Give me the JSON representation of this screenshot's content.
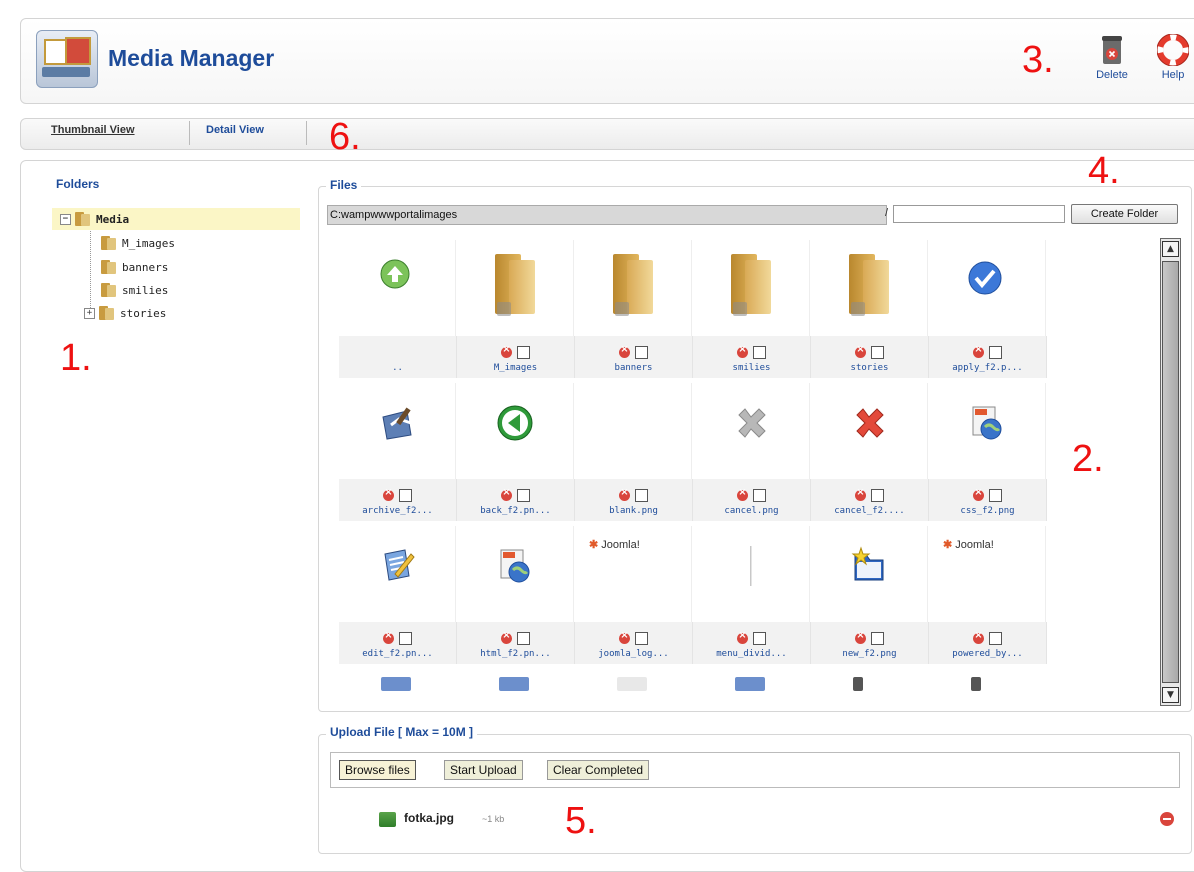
{
  "header": {
    "title": "Media Manager",
    "toolbar": {
      "delete_label": "Delete",
      "help_label": "Help"
    }
  },
  "view_tabs": {
    "thumbnail": "Thumbnail View",
    "detail": "Detail View"
  },
  "folders": {
    "title": "Folders",
    "root": "Media",
    "children": [
      "M_images",
      "banners",
      "smilies",
      "stories"
    ]
  },
  "files": {
    "legend": "Files",
    "path": "C:wampwwwportalimages",
    "path_separator": "/",
    "folder_input_value": "",
    "create_folder_label": "Create Folder",
    "rows": [
      [
        {
          "name": "..",
          "icon": "up-arrow-icon",
          "controls": false
        },
        {
          "name": "M_images",
          "icon": "folder-icon",
          "controls": true
        },
        {
          "name": "banners",
          "icon": "folder-icon",
          "controls": true
        },
        {
          "name": "smilies",
          "icon": "folder-icon",
          "controls": true
        },
        {
          "name": "stories",
          "icon": "folder-icon",
          "controls": true
        },
        {
          "name": "apply_f2.p...",
          "icon": "checkmark-icon",
          "controls": true
        }
      ],
      [
        {
          "name": "archive_f2...",
          "icon": "archive-icon",
          "controls": true
        },
        {
          "name": "back_f2.pn...",
          "icon": "back-arrow-icon",
          "controls": true
        },
        {
          "name": "blank.png",
          "icon": "blank-icon",
          "controls": true
        },
        {
          "name": "cancel.png",
          "icon": "grey-x-icon",
          "controls": true
        },
        {
          "name": "cancel_f2....",
          "icon": "red-x-icon",
          "controls": true
        },
        {
          "name": "css_f2.png",
          "icon": "globe-page-icon",
          "controls": true
        }
      ],
      [
        {
          "name": "edit_f2.pn...",
          "icon": "edit-icon",
          "controls": true
        },
        {
          "name": "html_f2.pn...",
          "icon": "globe-page-icon",
          "controls": true
        },
        {
          "name": "joomla_log...",
          "icon": "joomla-logo-icon",
          "controls": true,
          "logo_text": "Joomla!"
        },
        {
          "name": "menu_divid...",
          "icon": "divider-icon",
          "controls": true
        },
        {
          "name": "new_f2.png",
          "icon": "new-folder-icon",
          "controls": true
        },
        {
          "name": "powered_by...",
          "icon": "powered-by-icon",
          "controls": true,
          "logo_text": "Joomla!"
        }
      ]
    ]
  },
  "upload": {
    "legend": "Upload File [ Max = 10M ]",
    "browse_label": "Browse files",
    "start_label": "Start Upload",
    "clear_label": "Clear Completed",
    "queue": [
      {
        "name": "fotka.jpg",
        "size": "~1 kb"
      }
    ]
  },
  "annotations": [
    "1.",
    "2.",
    "3.",
    "4.",
    "5.",
    "6."
  ]
}
